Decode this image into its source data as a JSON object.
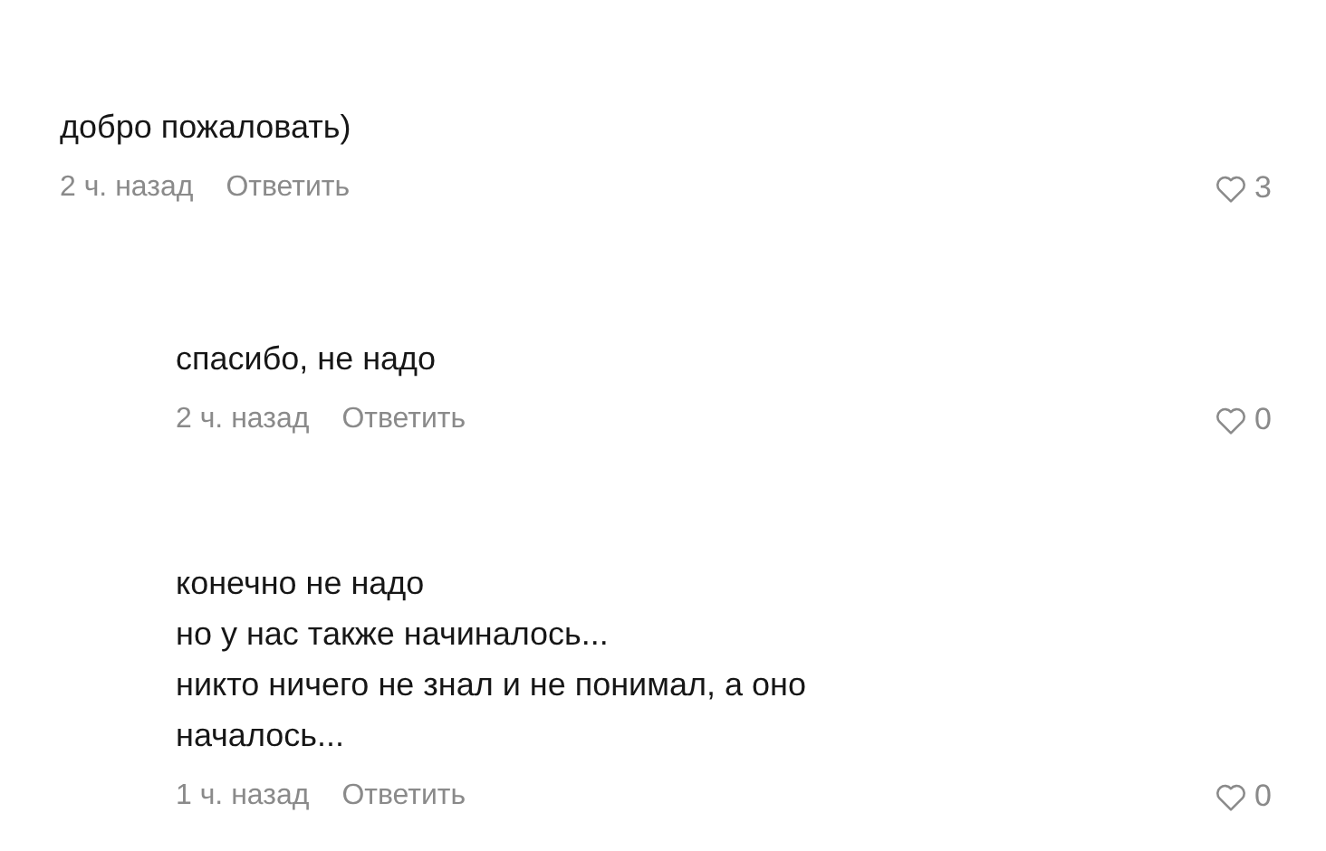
{
  "comments": [
    {
      "text": "добро пожаловать)",
      "time": "2 ч. назад",
      "reply": "Ответить",
      "likes": "3",
      "is_reply": false
    },
    {
      "text": "спасибо, не надо",
      "time": "2 ч. назад",
      "reply": "Ответить",
      "likes": "0",
      "is_reply": true
    },
    {
      "text": "конечно не надо\nно у нас также начиналось...\nникто ничего не знал и не понимал, а оно\nначалось...",
      "time": "1 ч. назад",
      "reply": "Ответить",
      "likes": "0",
      "is_reply": true
    }
  ]
}
